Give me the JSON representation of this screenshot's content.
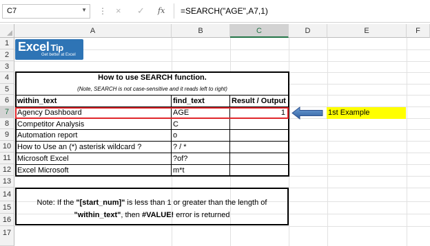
{
  "formula_bar": {
    "name_box": "C7",
    "formula": "=SEARCH(\"AGE\",A7,1)",
    "fx_label": "fx",
    "cancel_icon": "×",
    "enter_icon": "✓"
  },
  "columns": [
    "A",
    "B",
    "C",
    "D",
    "E",
    "F"
  ],
  "rows": [
    "1",
    "2",
    "3",
    "4",
    "5",
    "6",
    "7",
    "8",
    "9",
    "10",
    "11",
    "12",
    "13",
    "14",
    "15",
    "16",
    "17"
  ],
  "logo": {
    "big": "Excel",
    "tip": "Tip",
    "tagline": "Get better at Excel"
  },
  "table": {
    "title": "How to use SEARCH function.",
    "note": "(Note, SEARCH is not case-sensitive and it reads left to right)",
    "headers": [
      "within_text",
      "find_text",
      "Result / Output"
    ],
    "rows": [
      {
        "within": "Agency Dashboard",
        "find": "AGE",
        "result": "1"
      },
      {
        "within": "Competitor Analysis",
        "find": "C",
        "result": ""
      },
      {
        "within": "Automation report",
        "find": "o",
        "result": ""
      },
      {
        "within": "How to Use an (*) asterisk wildcard ?",
        "find": "? / *",
        "result": ""
      },
      {
        "within": "Microsoft Excel",
        "find": "?of?",
        "result": ""
      },
      {
        "within": "Excel Microsoft",
        "find": "m*t",
        "result": ""
      }
    ]
  },
  "example_label": "1st Example",
  "note_box": {
    "p1": "Note: If the ",
    "b1": "\"[start_num]\"",
    "p2": " is less than 1 or greater than the length of",
    "b2": "\"within_text\"",
    "p3": ", then ",
    "b3": "#VALUE!",
    "p4": " error is returned"
  }
}
